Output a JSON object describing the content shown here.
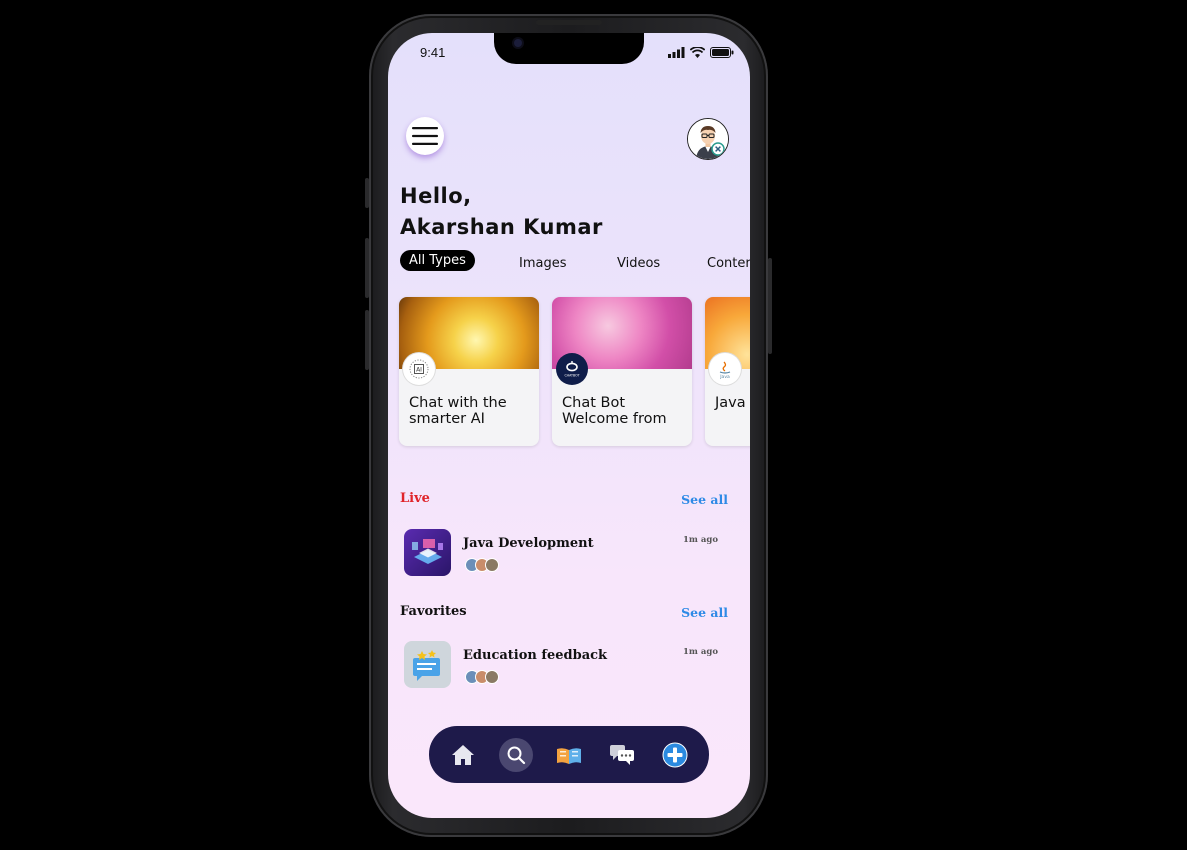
{
  "status": {
    "time": "9:41"
  },
  "header": {
    "menu_icon": "hamburger-icon",
    "avatar_icon": "user-avatar-icon"
  },
  "greeting": {
    "line1": "Hello,",
    "line2": "Akarshan Kumar"
  },
  "filters": [
    {
      "label": "All Types",
      "active": true
    },
    {
      "label": "Images",
      "active": false
    },
    {
      "label": "Videos",
      "active": false
    },
    {
      "label": "Conter",
      "active": false
    }
  ],
  "cards": [
    {
      "title": "Chat with the smarter AI",
      "badge": "AI"
    },
    {
      "title": "Chat Bot Welcome from",
      "badge": "CHATBOT"
    },
    {
      "title": "Java Devel",
      "badge": "Java"
    }
  ],
  "live": {
    "title": "Live",
    "see_all": "See all",
    "item": {
      "title": "Java Development",
      "time": "1m ago"
    }
  },
  "favorites": {
    "title": "Favorites",
    "see_all": "See all",
    "item": {
      "title": "Education feedback",
      "time": "1m ago"
    }
  },
  "colors": {
    "accent": "#2e8ae6",
    "live": "#e0242a",
    "tabbar": "#1e1a4a"
  },
  "tabbar": [
    "home-icon",
    "search-icon",
    "library-icon",
    "chat-icon",
    "add-icon"
  ]
}
